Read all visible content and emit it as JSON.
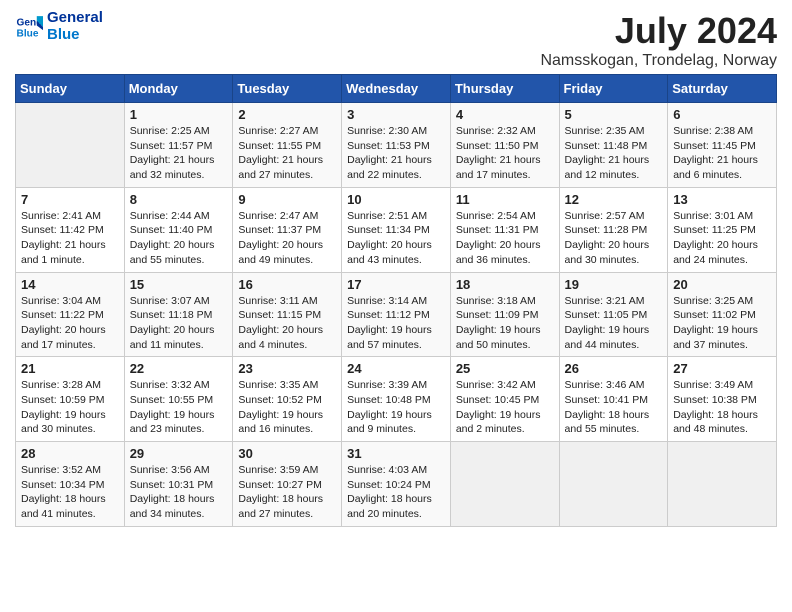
{
  "header": {
    "logo_line1": "General",
    "logo_line2": "Blue",
    "month_year": "July 2024",
    "location": "Namsskogan, Trondelag, Norway"
  },
  "days_of_week": [
    "Sunday",
    "Monday",
    "Tuesday",
    "Wednesday",
    "Thursday",
    "Friday",
    "Saturday"
  ],
  "weeks": [
    [
      {
        "day": "",
        "info": ""
      },
      {
        "day": "1",
        "info": "Sunrise: 2:25 AM\nSunset: 11:57 PM\nDaylight: 21 hours\nand 32 minutes."
      },
      {
        "day": "2",
        "info": "Sunrise: 2:27 AM\nSunset: 11:55 PM\nDaylight: 21 hours\nand 27 minutes."
      },
      {
        "day": "3",
        "info": "Sunrise: 2:30 AM\nSunset: 11:53 PM\nDaylight: 21 hours\nand 22 minutes."
      },
      {
        "day": "4",
        "info": "Sunrise: 2:32 AM\nSunset: 11:50 PM\nDaylight: 21 hours\nand 17 minutes."
      },
      {
        "day": "5",
        "info": "Sunrise: 2:35 AM\nSunset: 11:48 PM\nDaylight: 21 hours\nand 12 minutes."
      },
      {
        "day": "6",
        "info": "Sunrise: 2:38 AM\nSunset: 11:45 PM\nDaylight: 21 hours\nand 6 minutes."
      }
    ],
    [
      {
        "day": "7",
        "info": "Sunrise: 2:41 AM\nSunset: 11:42 PM\nDaylight: 21 hours\nand 1 minute."
      },
      {
        "day": "8",
        "info": "Sunrise: 2:44 AM\nSunset: 11:40 PM\nDaylight: 20 hours\nand 55 minutes."
      },
      {
        "day": "9",
        "info": "Sunrise: 2:47 AM\nSunset: 11:37 PM\nDaylight: 20 hours\nand 49 minutes."
      },
      {
        "day": "10",
        "info": "Sunrise: 2:51 AM\nSunset: 11:34 PM\nDaylight: 20 hours\nand 43 minutes."
      },
      {
        "day": "11",
        "info": "Sunrise: 2:54 AM\nSunset: 11:31 PM\nDaylight: 20 hours\nand 36 minutes."
      },
      {
        "day": "12",
        "info": "Sunrise: 2:57 AM\nSunset: 11:28 PM\nDaylight: 20 hours\nand 30 minutes."
      },
      {
        "day": "13",
        "info": "Sunrise: 3:01 AM\nSunset: 11:25 PM\nDaylight: 20 hours\nand 24 minutes."
      }
    ],
    [
      {
        "day": "14",
        "info": "Sunrise: 3:04 AM\nSunset: 11:22 PM\nDaylight: 20 hours\nand 17 minutes."
      },
      {
        "day": "15",
        "info": "Sunrise: 3:07 AM\nSunset: 11:18 PM\nDaylight: 20 hours\nand 11 minutes."
      },
      {
        "day": "16",
        "info": "Sunrise: 3:11 AM\nSunset: 11:15 PM\nDaylight: 20 hours\nand 4 minutes."
      },
      {
        "day": "17",
        "info": "Sunrise: 3:14 AM\nSunset: 11:12 PM\nDaylight: 19 hours\nand 57 minutes."
      },
      {
        "day": "18",
        "info": "Sunrise: 3:18 AM\nSunset: 11:09 PM\nDaylight: 19 hours\nand 50 minutes."
      },
      {
        "day": "19",
        "info": "Sunrise: 3:21 AM\nSunset: 11:05 PM\nDaylight: 19 hours\nand 44 minutes."
      },
      {
        "day": "20",
        "info": "Sunrise: 3:25 AM\nSunset: 11:02 PM\nDaylight: 19 hours\nand 37 minutes."
      }
    ],
    [
      {
        "day": "21",
        "info": "Sunrise: 3:28 AM\nSunset: 10:59 PM\nDaylight: 19 hours\nand 30 minutes."
      },
      {
        "day": "22",
        "info": "Sunrise: 3:32 AM\nSunset: 10:55 PM\nDaylight: 19 hours\nand 23 minutes."
      },
      {
        "day": "23",
        "info": "Sunrise: 3:35 AM\nSunset: 10:52 PM\nDaylight: 19 hours\nand 16 minutes."
      },
      {
        "day": "24",
        "info": "Sunrise: 3:39 AM\nSunset: 10:48 PM\nDaylight: 19 hours\nand 9 minutes."
      },
      {
        "day": "25",
        "info": "Sunrise: 3:42 AM\nSunset: 10:45 PM\nDaylight: 19 hours\nand 2 minutes."
      },
      {
        "day": "26",
        "info": "Sunrise: 3:46 AM\nSunset: 10:41 PM\nDaylight: 18 hours\nand 55 minutes."
      },
      {
        "day": "27",
        "info": "Sunrise: 3:49 AM\nSunset: 10:38 PM\nDaylight: 18 hours\nand 48 minutes."
      }
    ],
    [
      {
        "day": "28",
        "info": "Sunrise: 3:52 AM\nSunset: 10:34 PM\nDaylight: 18 hours\nand 41 minutes."
      },
      {
        "day": "29",
        "info": "Sunrise: 3:56 AM\nSunset: 10:31 PM\nDaylight: 18 hours\nand 34 minutes."
      },
      {
        "day": "30",
        "info": "Sunrise: 3:59 AM\nSunset: 10:27 PM\nDaylight: 18 hours\nand 27 minutes."
      },
      {
        "day": "31",
        "info": "Sunrise: 4:03 AM\nSunset: 10:24 PM\nDaylight: 18 hours\nand 20 minutes."
      },
      {
        "day": "",
        "info": ""
      },
      {
        "day": "",
        "info": ""
      },
      {
        "day": "",
        "info": ""
      }
    ]
  ]
}
